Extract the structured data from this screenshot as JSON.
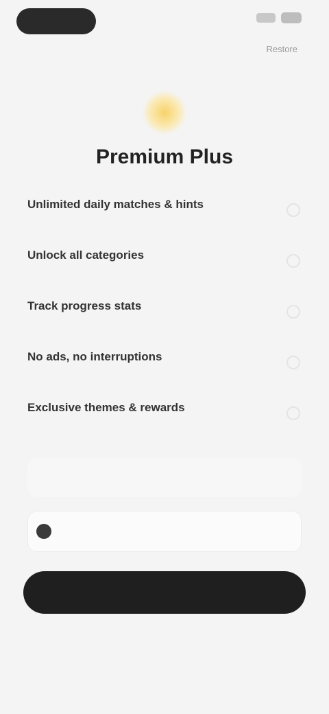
{
  "status_bar": {
    "time": ""
  },
  "header": {
    "restore_label": "Restore"
  },
  "hero": {
    "icon": "crown-icon",
    "title": "Premium Plus"
  },
  "features": [
    {
      "label": "Unlimited daily matches & hints",
      "sub": ""
    },
    {
      "label": "Unlock all categories",
      "sub": ""
    },
    {
      "label": "Track progress stats",
      "sub": ""
    },
    {
      "label": "No ads, no interruptions",
      "sub": ""
    },
    {
      "label": "Exclusive themes & rewards",
      "sub": ""
    }
  ],
  "price_card": {
    "text": ""
  },
  "trial": {
    "text": ""
  },
  "cta": {
    "label": ""
  },
  "footer": {
    "small": "",
    "legal": "",
    "links": [
      "",
      ""
    ]
  },
  "colors": {
    "accent": "#f8d36a",
    "cta": "#1f1f1f",
    "background": "#f4f4f4"
  }
}
